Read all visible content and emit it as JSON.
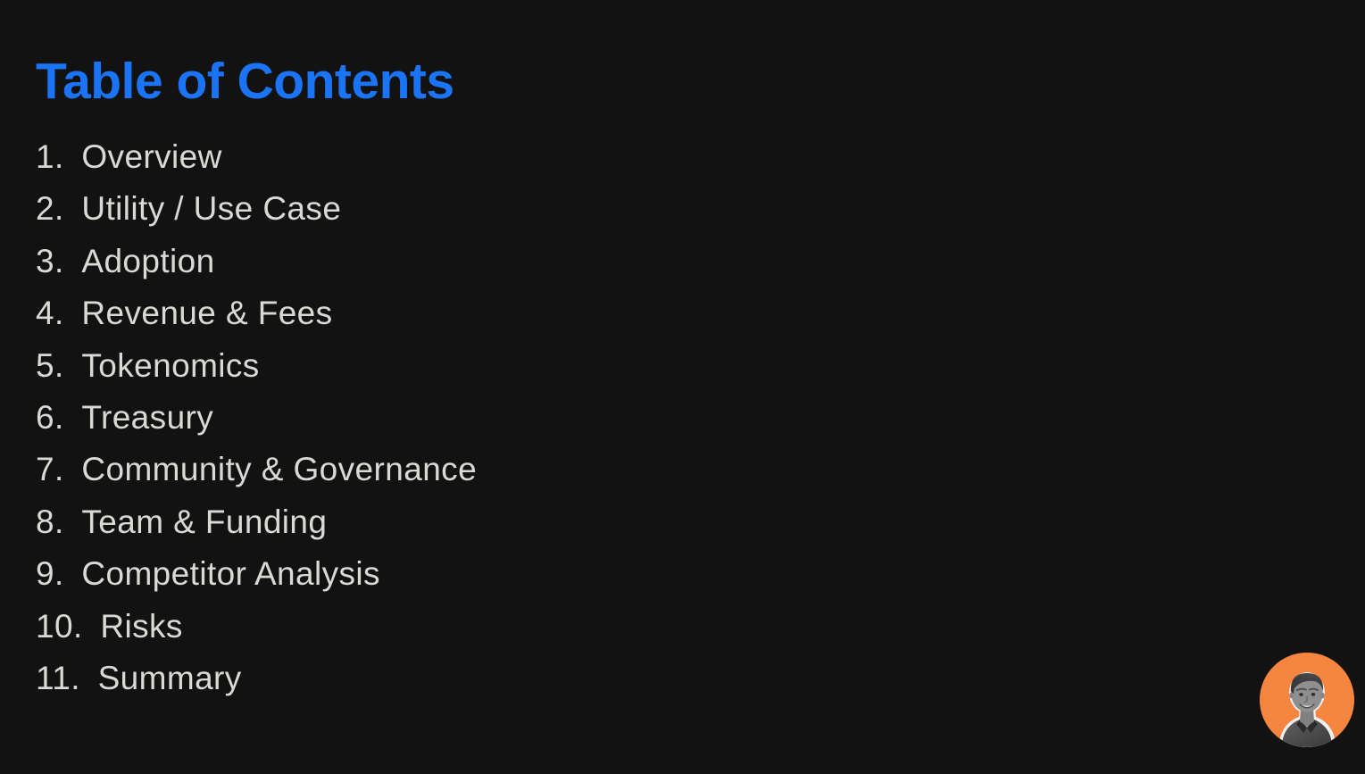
{
  "slide": {
    "title": "Table of Contents",
    "background_color": "#121212",
    "title_color": "#1a74f5",
    "list_text_color": "#d9d9d5"
  },
  "toc": {
    "items": [
      {
        "number": "1.",
        "label": "Overview"
      },
      {
        "number": "2.",
        "label": "Utility / Use Case"
      },
      {
        "number": "3.",
        "label": "Adoption"
      },
      {
        "number": "4.",
        "label": "Revenue & Fees"
      },
      {
        "number": "5.",
        "label": "Tokenomics"
      },
      {
        "number": "6.",
        "label": "Treasury"
      },
      {
        "number": "7.",
        "label": "Community & Governance"
      },
      {
        "number": "8.",
        "label": "Team & Funding"
      },
      {
        "number": "9.",
        "label": "Competitor Analysis"
      },
      {
        "number": "10.",
        "label": "Risks"
      },
      {
        "number": "11.",
        "label": "Summary"
      }
    ]
  },
  "avatar": {
    "icon": "presenter-avatar-photo",
    "background_color": "#f5853f",
    "outline_color": "#f2f2f2",
    "person_tone": "#6f6f6f"
  }
}
